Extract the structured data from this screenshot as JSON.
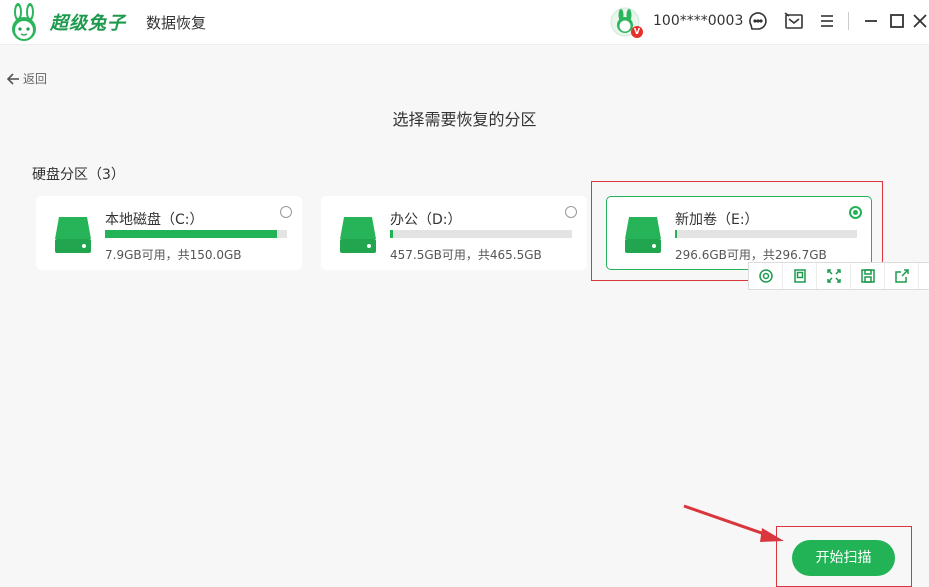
{
  "titlebar": {
    "brand": "超级兔子",
    "product": "数据恢复",
    "user_id": "100****0003",
    "vip_badge": "V",
    "icons": [
      "help-icon",
      "message-icon",
      "menu-icon",
      "minimize-icon",
      "maximize-icon",
      "close-icon"
    ]
  },
  "nav": {
    "back_label": "返回"
  },
  "page": {
    "title": "选择需要恢复的分区",
    "section_label": "硬盘分区（3）"
  },
  "partitions": [
    {
      "name": "本地磁盘（C:）",
      "capacity": "7.9GB可用，共150.0GB",
      "used_fraction": 0.947,
      "selected": false
    },
    {
      "name": "办公（D:）",
      "capacity": "457.5GB可用，共465.5GB",
      "used_fraction": 0.017,
      "selected": false
    },
    {
      "name": "新加卷（E:）",
      "capacity": "296.6GB可用，共296.7GB",
      "used_fraction": 0.003,
      "selected": true
    }
  ],
  "floating_toolbar": {
    "icons": [
      "scan-circle-icon",
      "copy-icon",
      "fullscreen-icon",
      "save-icon",
      "share-icon",
      "settings-icon"
    ]
  },
  "actions": {
    "start_scan": "开始扫描"
  },
  "colors": {
    "accent": "#22b357",
    "annotation": "#d9363e",
    "brand": "#1e9a4e"
  }
}
